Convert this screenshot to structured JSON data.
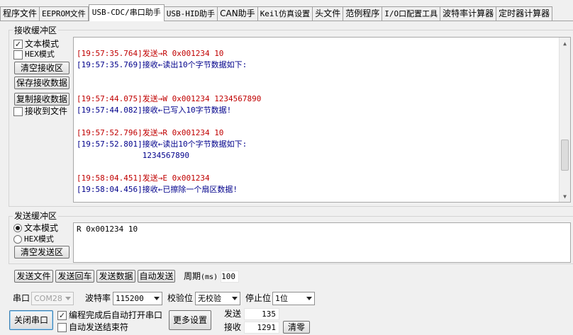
{
  "tabs": [
    {
      "label": "程序文件",
      "active": false
    },
    {
      "label": "EEPROM文件",
      "active": false
    },
    {
      "label": "USB-CDC/串口助手",
      "active": true
    },
    {
      "label": "USB-HID助手",
      "active": false
    },
    {
      "label": "CAN助手",
      "active": false
    },
    {
      "label": "Keil仿真设置",
      "active": false
    },
    {
      "label": "头文件",
      "active": false
    },
    {
      "label": "范例程序",
      "active": false
    },
    {
      "label": "I/O口配置工具",
      "active": false
    },
    {
      "label": "波特率计算器",
      "active": false
    },
    {
      "label": "定时器计算器",
      "active": false
    }
  ],
  "receive": {
    "group_label": "接收缓冲区",
    "text_mode_label": "文本模式",
    "text_mode_checked": true,
    "hex_mode_label": "HEX模式",
    "hex_mode_checked": false,
    "clear_button": "清空接收区",
    "save_button": "保存接收数据",
    "copy_button": "复制接收数据",
    "to_file_label": "接收到文件",
    "to_file_checked": false,
    "log": [
      {
        "ts": "[19:57:35.764]",
        "text": "发送→R 0x001234 10",
        "color": "red"
      },
      {
        "ts": "[19:57:35.769]",
        "text": "接收←读出10个字节数据如下:",
        "color": "blue"
      },
      {
        "ts": "",
        "text": "",
        "color": "blue"
      },
      {
        "ts": "",
        "text": "",
        "color": "blue"
      },
      {
        "ts": "[19:57:44.075]",
        "text": "发送→W 0x001234 1234567890",
        "color": "red"
      },
      {
        "ts": "[19:57:44.082]",
        "text": "接收←已写入10字节数据!",
        "color": "blue"
      },
      {
        "ts": "",
        "text": "",
        "color": "blue"
      },
      {
        "ts": "[19:57:52.796]",
        "text": "发送→R 0x001234 10",
        "color": "red"
      },
      {
        "ts": "[19:57:52.801]",
        "text": "接收←读出10个字节数据如下:",
        "color": "blue"
      },
      {
        "ts": "",
        "text": "              1234567890",
        "color": "blue"
      },
      {
        "ts": "",
        "text": "",
        "color": "blue"
      },
      {
        "ts": "[19:58:04.451]",
        "text": "发送→E 0x001234",
        "color": "red"
      },
      {
        "ts": "[19:58:04.456]",
        "text": "接收←已擦除一个扇区数据!",
        "color": "blue"
      }
    ]
  },
  "send": {
    "group_label": "发送缓冲区",
    "text_mode_label": "文本模式",
    "text_mode_selected": true,
    "hex_mode_label": "HEX模式",
    "clear_button": "清空发送区",
    "content": "R 0x001234 10"
  },
  "actions": {
    "send_file": "发送文件",
    "send_cr": "发送回车",
    "send_data": "发送数据",
    "auto_send": "自动发送",
    "period_label": "周期",
    "period_unit": "(ms)",
    "period_value": "100"
  },
  "port": {
    "port_label": "串口",
    "port_value": "COM28",
    "baud_label": "波特率",
    "baud_value": "115200",
    "parity_label": "校验位",
    "parity_value": "无校验",
    "stop_label": "停止位",
    "stop_value": "1位",
    "close_button": "关闭串口",
    "auto_open_label": "编程完成后自动打开串口",
    "auto_open_checked": true,
    "auto_send_end_label": "自动发送结束符",
    "auto_send_end_checked": false,
    "more_button": "更多设置",
    "sent_label": "发送",
    "sent_count": "135",
    "recv_label": "接收",
    "recv_count": "1291",
    "clear_count_button": "清零"
  }
}
